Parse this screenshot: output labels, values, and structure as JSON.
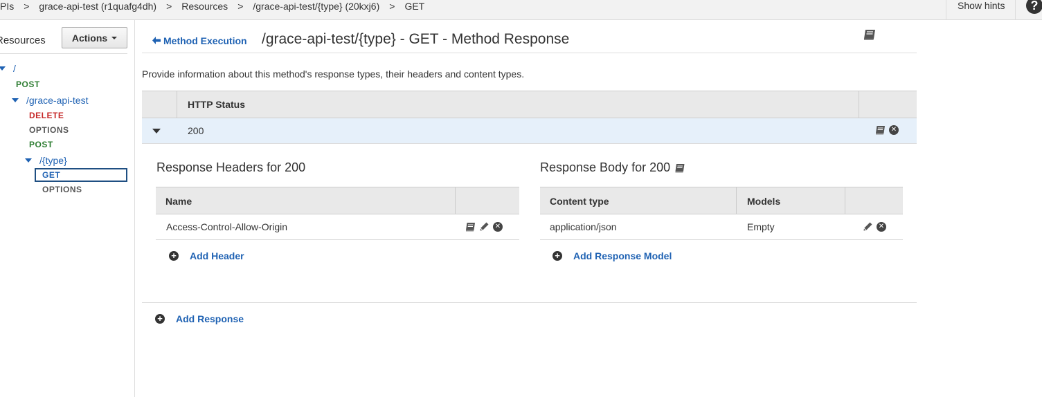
{
  "breadcrumb": {
    "items": [
      "PIs",
      "grace-api-test (r1quafg4dh)",
      "Resources",
      "/grace-api-test/{type} (20kxj6)",
      "GET"
    ],
    "separator": ">"
  },
  "topbar": {
    "show_hints": "Show hints",
    "help": "?"
  },
  "left_panel": {
    "title": "Resources",
    "actions_label": "Actions",
    "tree": {
      "root": "/",
      "root_post": "POST",
      "grace": "/grace-api-test",
      "grace_delete": "DELETE",
      "grace_options": "OPTIONS",
      "grace_post": "POST",
      "type": "/{type}",
      "type_get": "GET",
      "type_options": "OPTIONS"
    }
  },
  "header": {
    "back_label": "Method Execution",
    "title": "/grace-api-test/{type} - GET - Method Response"
  },
  "description": "Provide information about this method's response types, their headers and content types.",
  "status_table": {
    "column": "HTTP Status",
    "rows": [
      {
        "code": "200"
      }
    ]
  },
  "response_headers": {
    "title": "Response Headers for 200",
    "column_name": "Name",
    "rows": [
      {
        "name": "Access-Control-Allow-Origin"
      }
    ],
    "add_label": "Add Header"
  },
  "response_body": {
    "title": "Response Body for 200",
    "column_content_type": "Content type",
    "column_models": "Models",
    "rows": [
      {
        "content_type": "application/json",
        "model": "Empty"
      }
    ],
    "add_label": "Add Response Model"
  },
  "add_response_label": "Add Response",
  "colors": {
    "link": "#1f62b3",
    "post": "#2e7d32",
    "delete": "#c62828",
    "selected_row": "#e6f0fa"
  },
  "icons": [
    "book-icon",
    "pencil-icon",
    "remove-icon",
    "plus-circle-icon",
    "help-icon",
    "back-arrow-icon",
    "caret-down-icon"
  ]
}
